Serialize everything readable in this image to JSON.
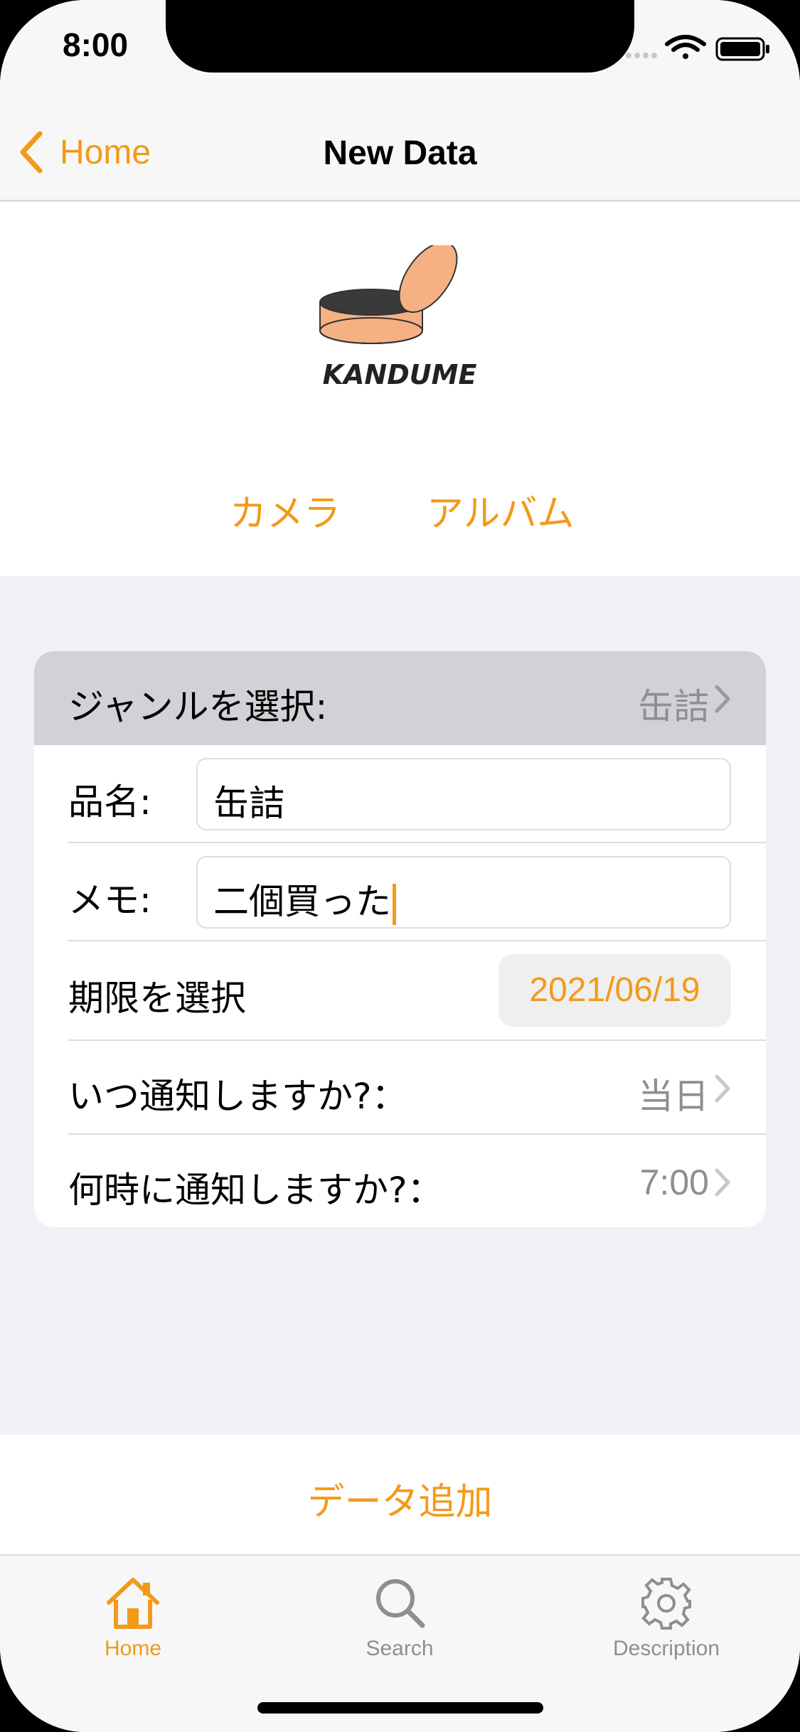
{
  "status_bar": {
    "time": "8:00"
  },
  "nav": {
    "back_label": "Home",
    "title": "New Data"
  },
  "header": {
    "logo_text": "KANDUME",
    "camera_label": "カメラ",
    "album_label": "アルバム"
  },
  "form": {
    "genre_label": "ジャンルを選択:",
    "genre_value": "缶詰",
    "name_label": "品名:",
    "name_value": "缶詰",
    "memo_label": "メモ:",
    "memo_value": "二個買った",
    "deadline_label": "期限を選択",
    "deadline_value": "2021/06/19",
    "notify_when_label": "いつ通知しますか?：",
    "notify_when_value": "当日",
    "notify_time_label": "何時に通知しますか?：",
    "notify_time_value": "7:00"
  },
  "actions": {
    "add_label": "データ追加"
  },
  "tabs": [
    {
      "label": "Home",
      "icon": "house-icon",
      "active": true
    },
    {
      "label": "Search",
      "icon": "magnifier-icon",
      "active": false
    },
    {
      "label": "Description",
      "icon": "gear-icon",
      "active": false
    }
  ],
  "colors": {
    "accent": "#f29a1a",
    "inactive": "#8e8e93",
    "genre_row_bg": "#d1d1d6"
  }
}
